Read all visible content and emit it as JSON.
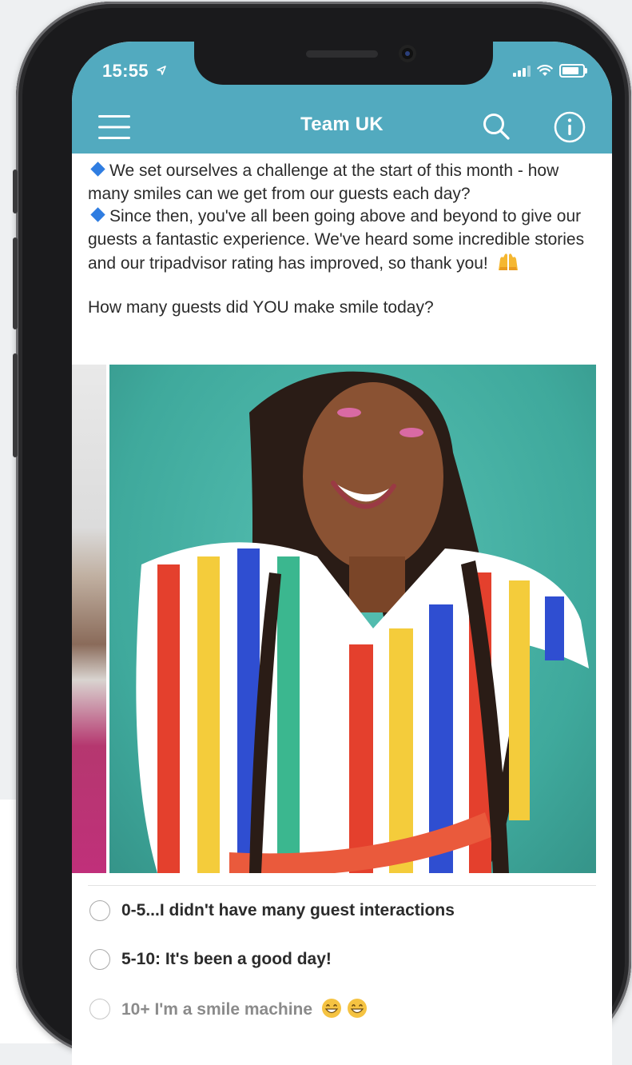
{
  "status_bar": {
    "time": "15:55"
  },
  "nav": {
    "title": "Team UK"
  },
  "post": {
    "paragraph1": "We set ourselves a challenge at the start of this month - how many smiles can we get from our guests each day?",
    "paragraph2": "Since then, you've all been going above and beyond to give our guests a fantastic experience. We've heard some incredible stories and our tripadvisor rating has improved, so thank you!",
    "question": "How many guests did YOU make smile today?"
  },
  "poll": {
    "options": [
      {
        "label": "0-5...I didn't have many guest interactions"
      },
      {
        "label": "5-10: It's been a good day!"
      },
      {
        "label": "10+ I'm a smile machine"
      }
    ]
  },
  "colors": {
    "header": "#52aabf",
    "bullet": "#2f7de1",
    "photo_background": "#3fa99c"
  },
  "icons": [
    "menu-icon",
    "search-icon",
    "info-icon",
    "location-arrow-icon",
    "raised-hands-emoji",
    "grinning-face-emoji"
  ]
}
